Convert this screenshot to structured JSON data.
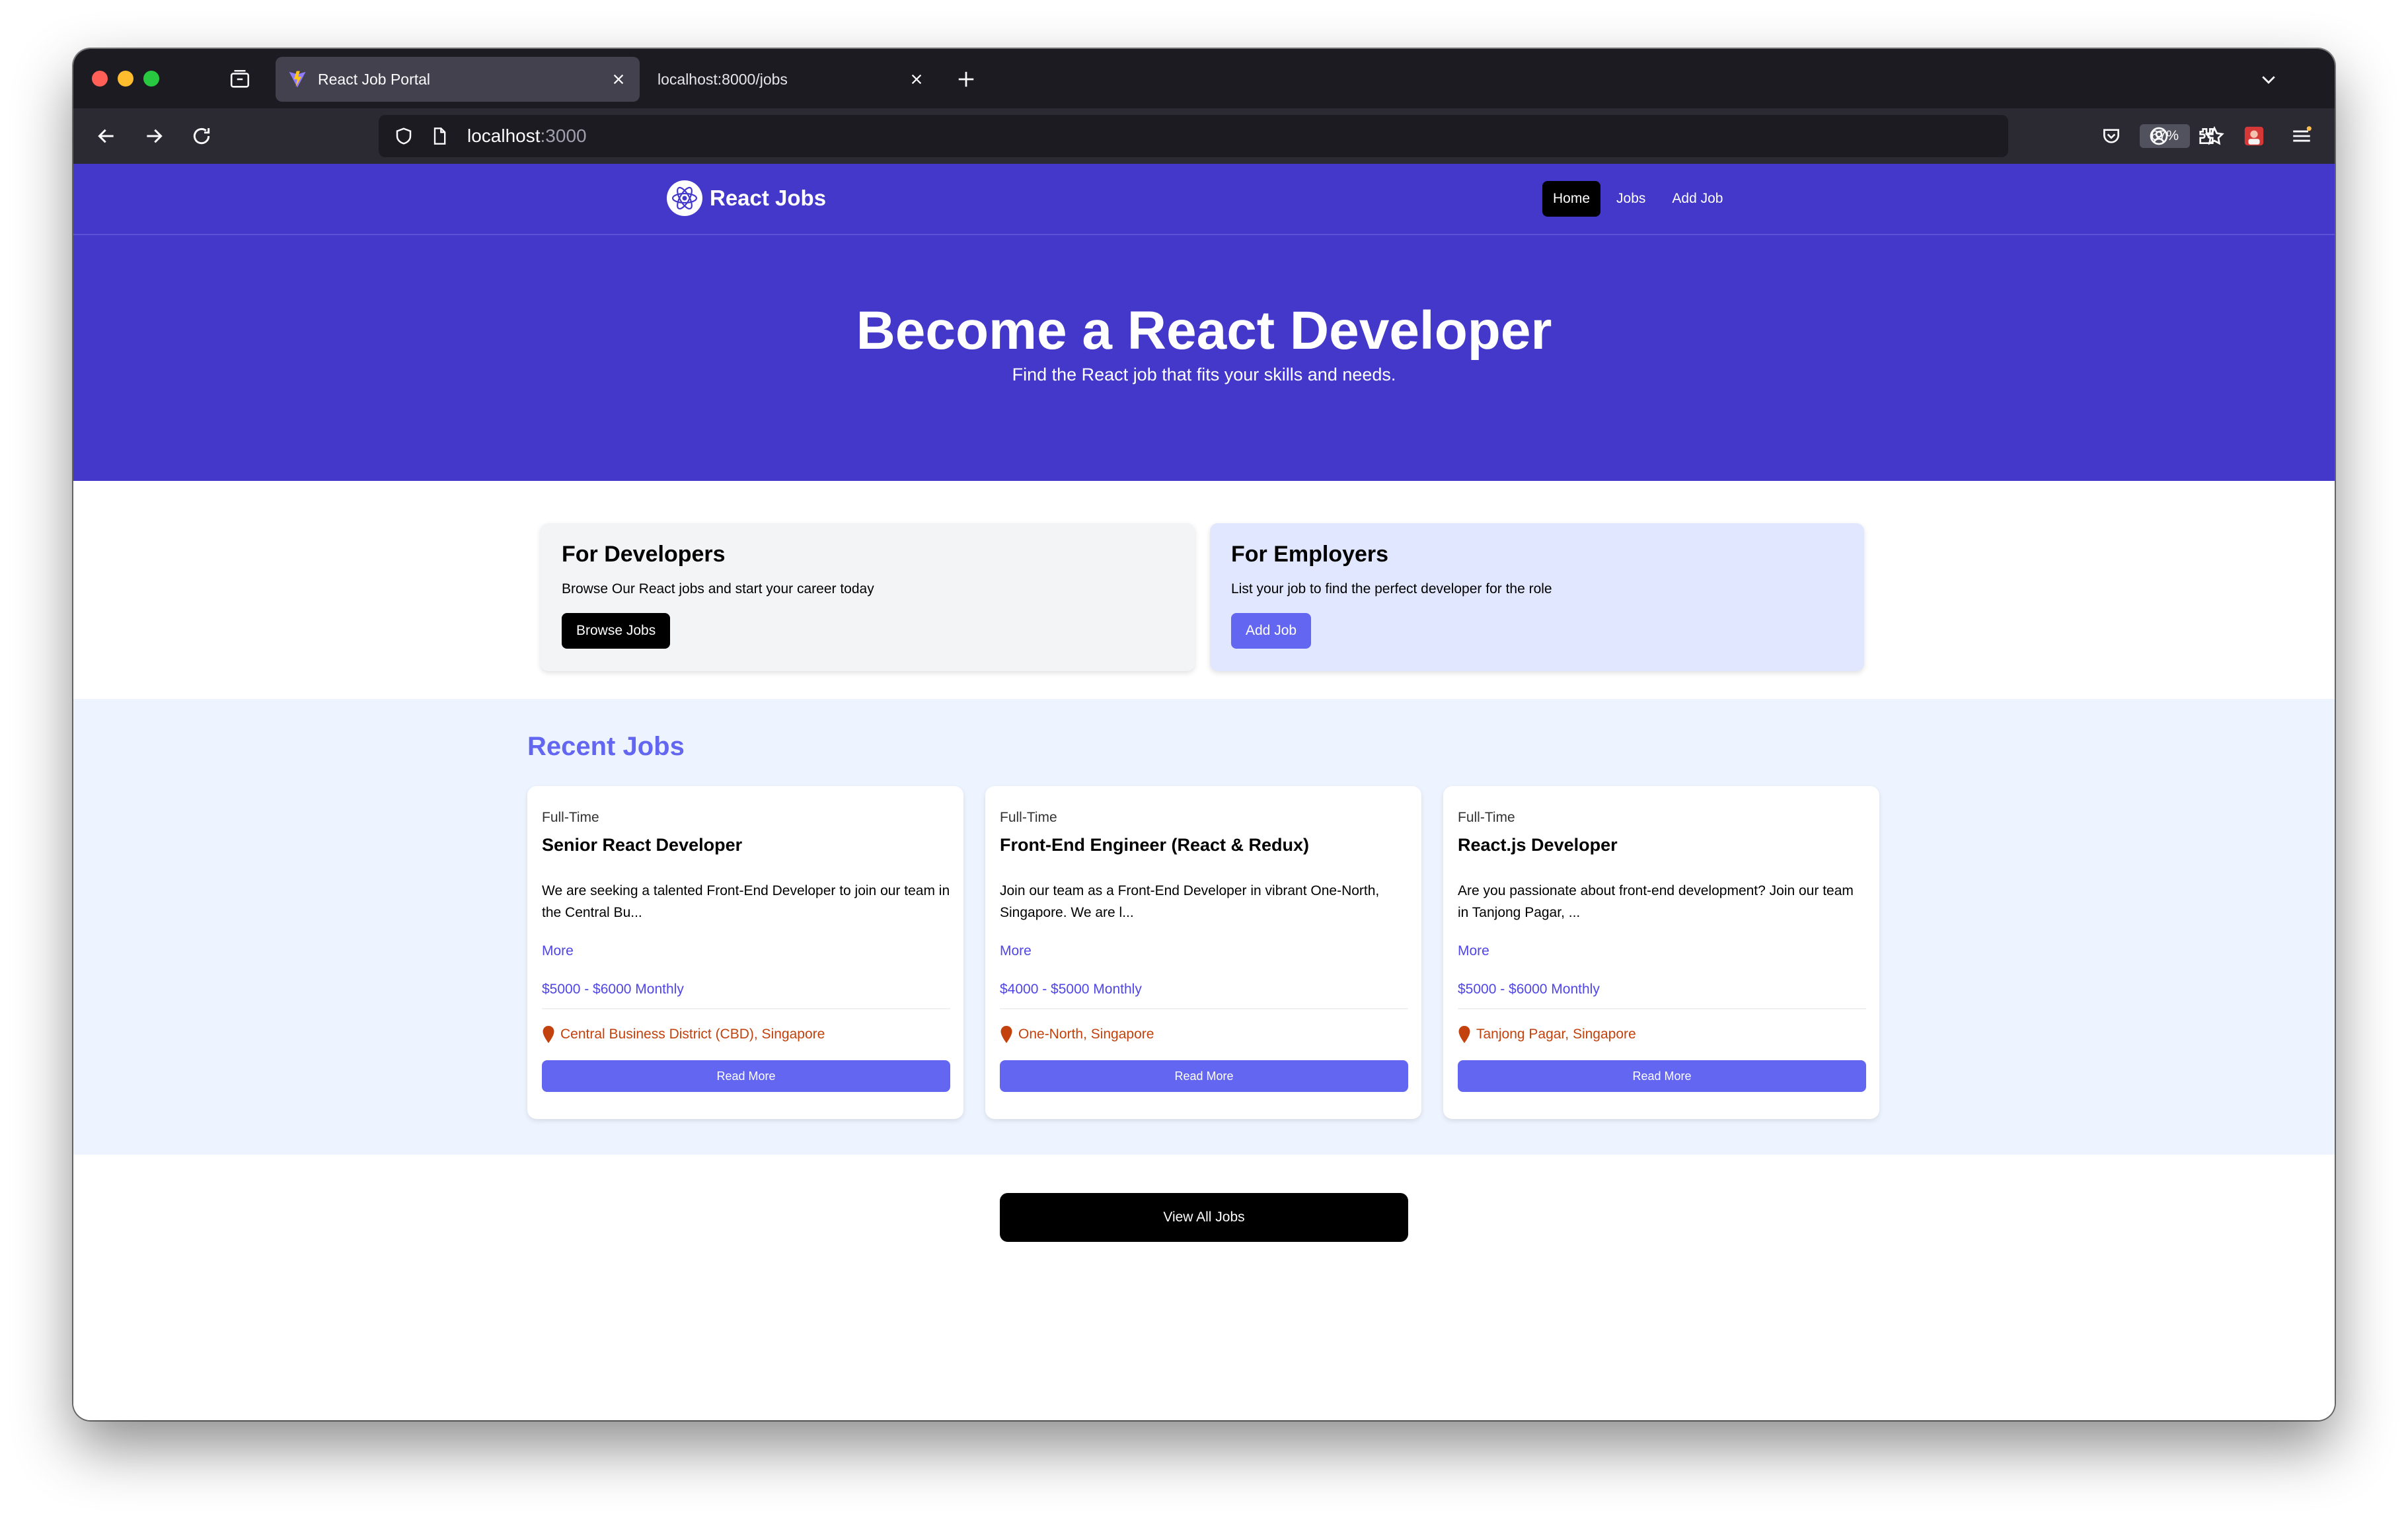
{
  "browser": {
    "tabs": [
      {
        "title": "React Job Portal",
        "active": true
      },
      {
        "title": "localhost:8000/jobs",
        "active": false
      }
    ],
    "url_host": "localhost",
    "url_port": ":3000",
    "zoom": "67%"
  },
  "site": {
    "brand": "React Jobs",
    "nav": [
      {
        "label": "Home",
        "active": true
      },
      {
        "label": "Jobs",
        "active": false
      },
      {
        "label": "Add Job",
        "active": false
      }
    ],
    "hero": {
      "title": "Become a React Developer",
      "subtitle": "Find the React job that fits your skills and needs."
    },
    "cards": [
      {
        "title": "For Developers",
        "text": "Browse Our React jobs and start your career today",
        "button": "Browse Jobs"
      },
      {
        "title": "For Employers",
        "text": "List your job to find the perfect developer for the role",
        "button": "Add Job"
      }
    ],
    "recent_title": "Recent Jobs",
    "jobs": [
      {
        "type": "Full-Time",
        "title": "Senior React Developer",
        "description": "We are seeking a talented Front-End Developer to join our team in the Central Bu...",
        "more": "More",
        "salary": "$5000 - $6000 Monthly",
        "location": "Central Business District (CBD), Singapore",
        "button": "Read More"
      },
      {
        "type": "Full-Time",
        "title": "Front-End Engineer (React & Redux)",
        "description": "Join our team as a Front-End Developer in vibrant One-North, Singapore. We are l...",
        "more": "More",
        "salary": "$4000 - $5000 Monthly",
        "location": "One-North, Singapore",
        "button": "Read More"
      },
      {
        "type": "Full-Time",
        "title": "React.js Developer",
        "description": "Are you passionate about front-end development? Join our team in Tanjong Pagar, ...",
        "more": "More",
        "salary": "$5000 - $6000 Monthly",
        "location": "Tanjong Pagar, Singapore",
        "button": "Read More"
      }
    ],
    "view_all": "View All Jobs"
  },
  "colors": {
    "brand": "#4338ca",
    "accent": "#6366f1",
    "location": "#c2410c"
  }
}
